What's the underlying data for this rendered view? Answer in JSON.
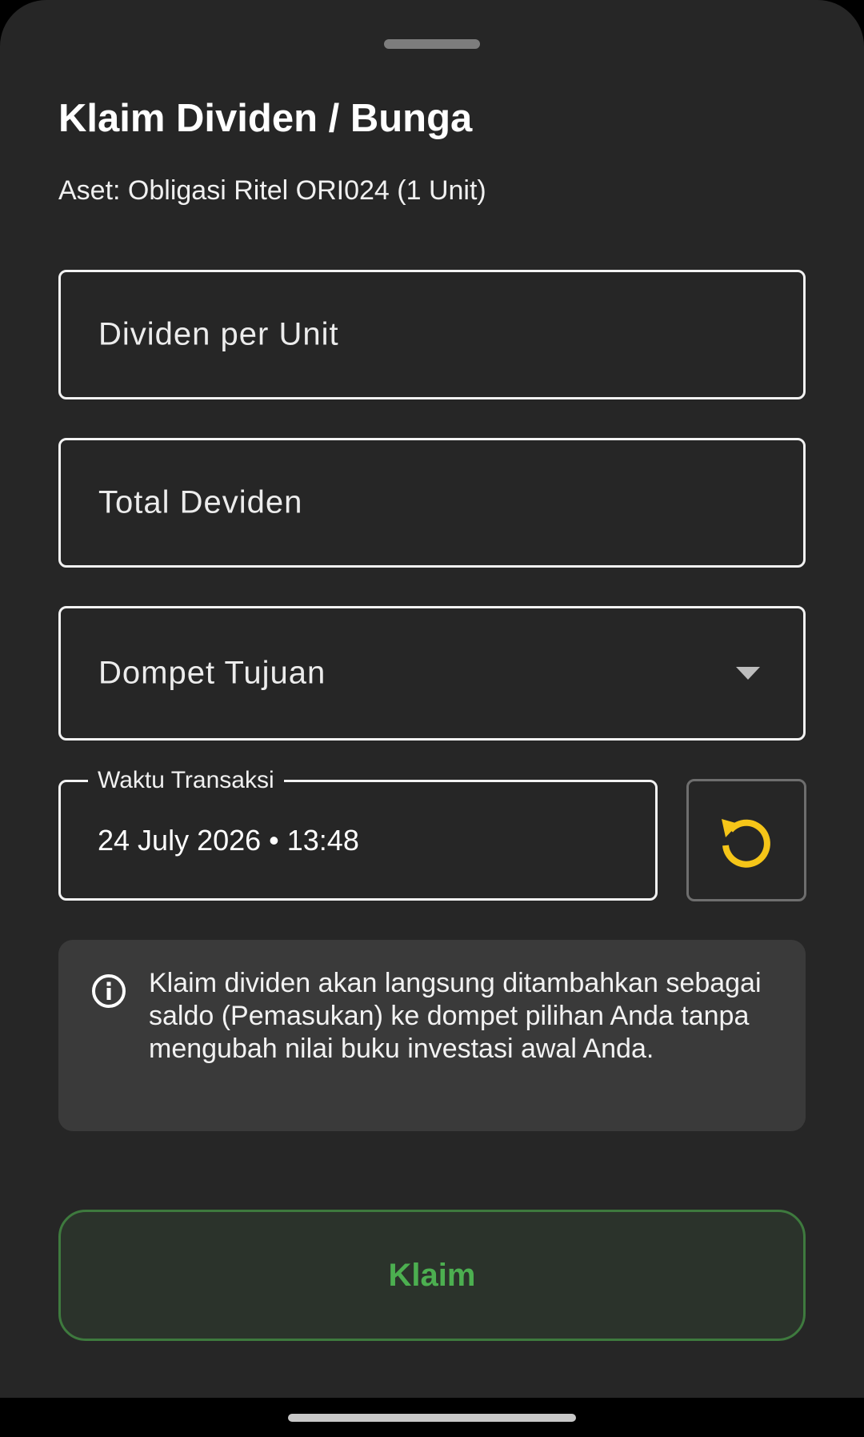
{
  "sheet": {
    "title": "Klaim Dividen / Bunga",
    "asset_info": "Aset: Obligasi Ritel ORI024 (1 Unit)"
  },
  "form": {
    "dividend_per_unit": {
      "placeholder": "Dividen per Unit",
      "value": ""
    },
    "total_dividend": {
      "placeholder": "Total Deviden",
      "value": ""
    },
    "destination_wallet": {
      "placeholder": "Dompet Tujuan",
      "selected": ""
    },
    "transaction_time": {
      "label": "Waktu Transaksi",
      "value": "24 July 2026 • 13:48"
    }
  },
  "info": {
    "icon": "info-icon",
    "text": "Klaim dividen akan langsung ditambahkan sebagai saldo (Pemasukan) ke dompet pilihan Anda tanpa mengubah nilai buku investasi awal Anda."
  },
  "actions": {
    "claim_label": "Klaim",
    "reset_icon": "reset-time-icon"
  },
  "colors": {
    "background": "#262626",
    "accent_green": "#4caf50",
    "reset_icon_yellow": "#f5c518",
    "info_box": "#3a3a3a"
  }
}
